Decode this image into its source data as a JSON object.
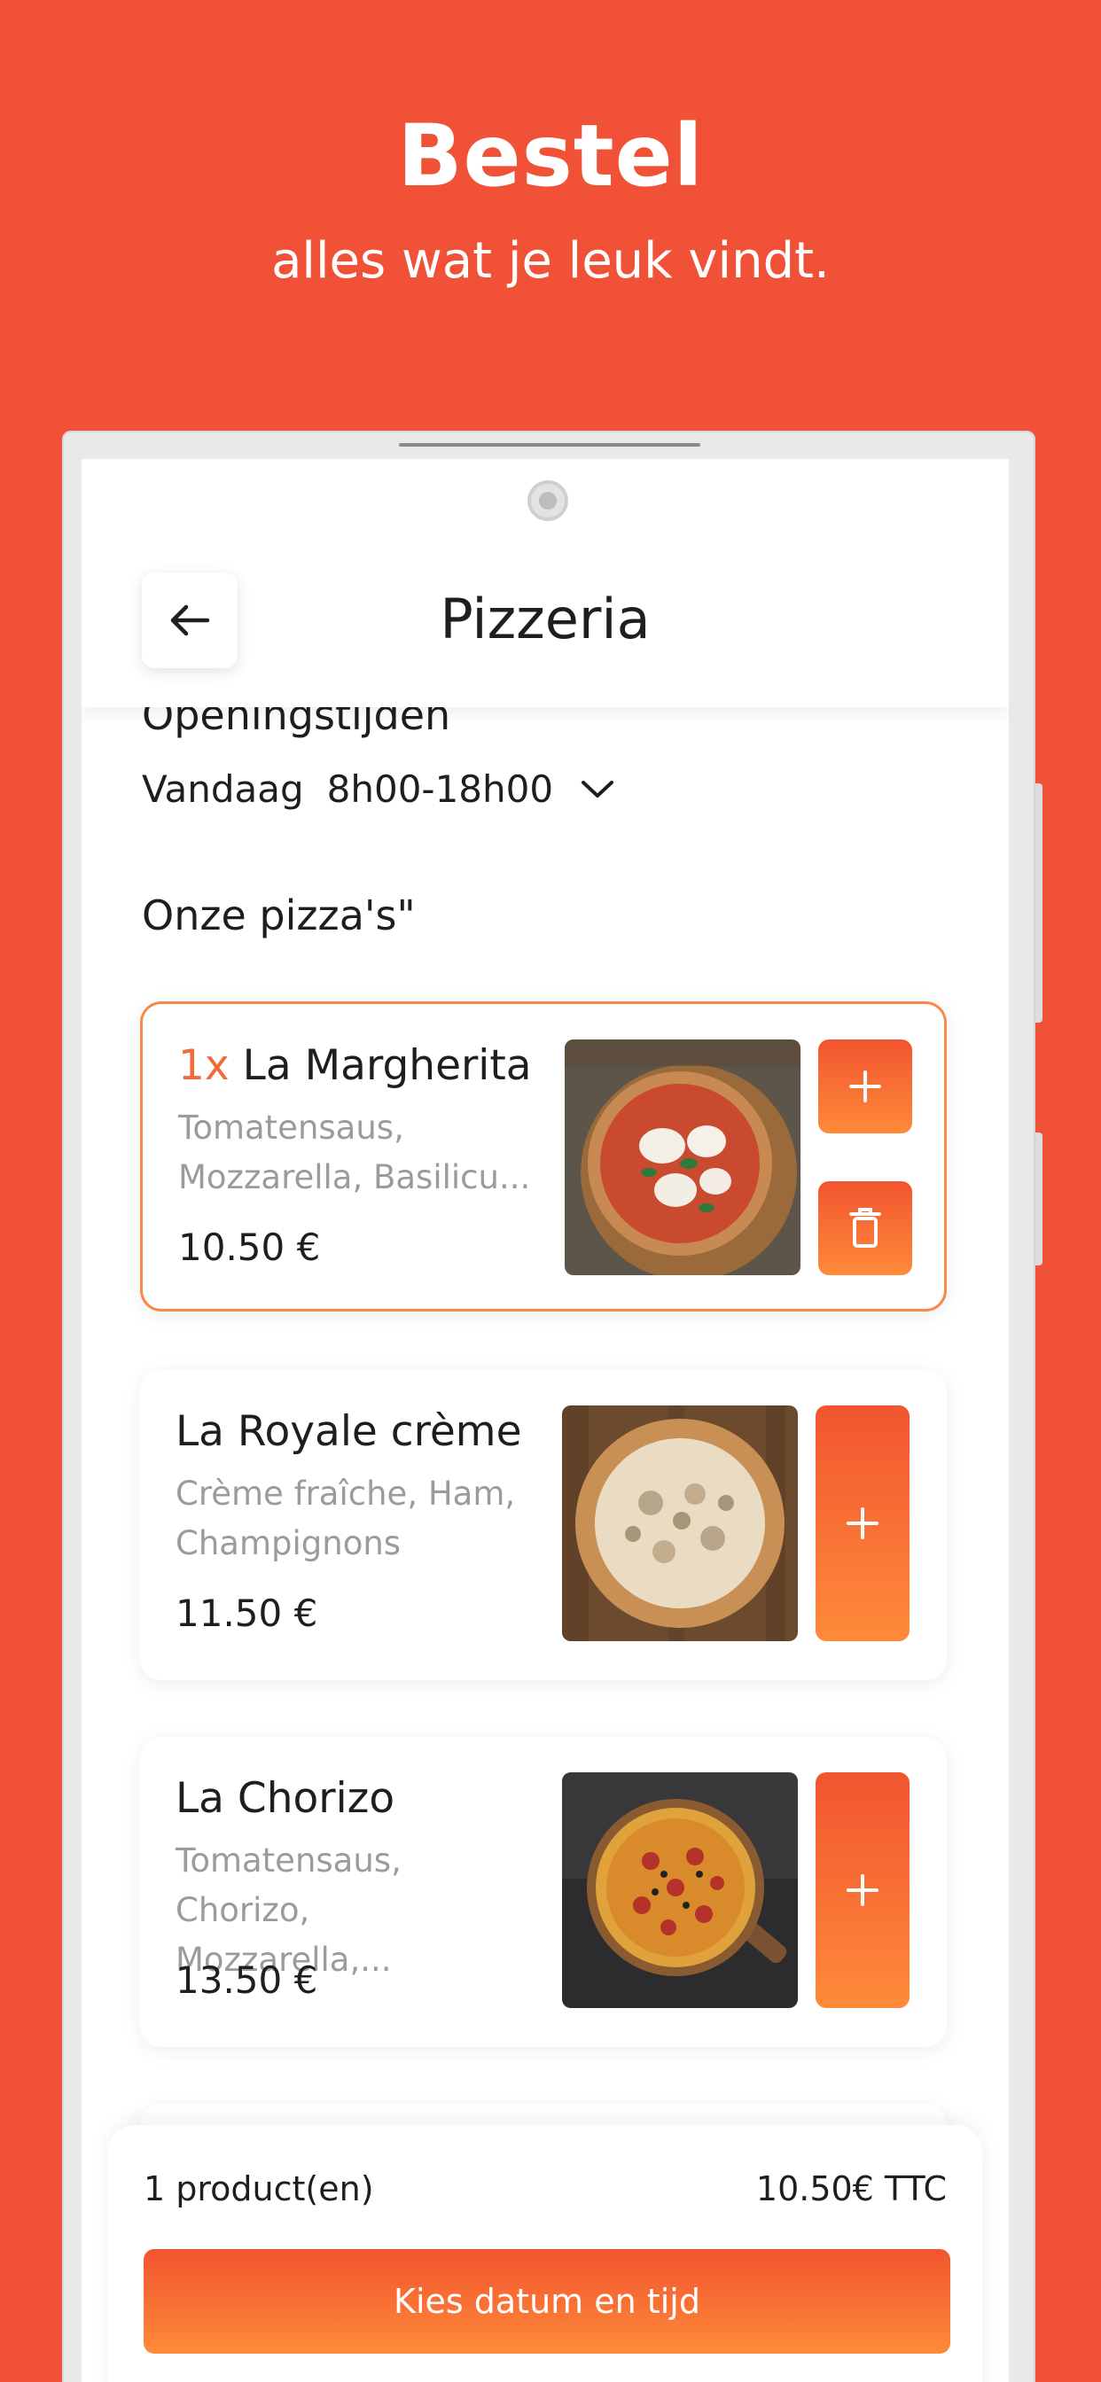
{
  "promo": {
    "title": "Bestel",
    "subtitle": "alles wat je leuk vindt."
  },
  "header": {
    "title": "Pizzeria",
    "back_icon": "arrow-left-icon"
  },
  "hours": {
    "title": "Openingstijden",
    "day": "Vandaag",
    "time": "8h00-18h00",
    "toggle_icon": "chevron-down-icon"
  },
  "section": {
    "title": "Onze pizza's\""
  },
  "products": [
    {
      "qty": "1x",
      "name": "La Margherita",
      "desc": "Tomatensaus, Mozzarella, Basilicu...",
      "price": "10.50 €",
      "selected": true
    },
    {
      "qty": "",
      "name": "La Royale crème",
      "desc": "Crème fraîche, Ham, Champignons",
      "price": "11.50 €",
      "selected": false
    },
    {
      "qty": "",
      "name": "La Chorizo",
      "desc": "Tomatensaus, Chorizo, Mozzarella,...",
      "price": "13.50 €",
      "selected": false
    }
  ],
  "cart": {
    "count": "1 product(en)",
    "total": "10.50€ TTC",
    "button_label": "Kies datum en tijd"
  },
  "colors": {
    "background": "#f05137",
    "accent_start": "#f2552f",
    "accent_end": "#ff8a3a",
    "selected_border": "#f58a4a"
  }
}
